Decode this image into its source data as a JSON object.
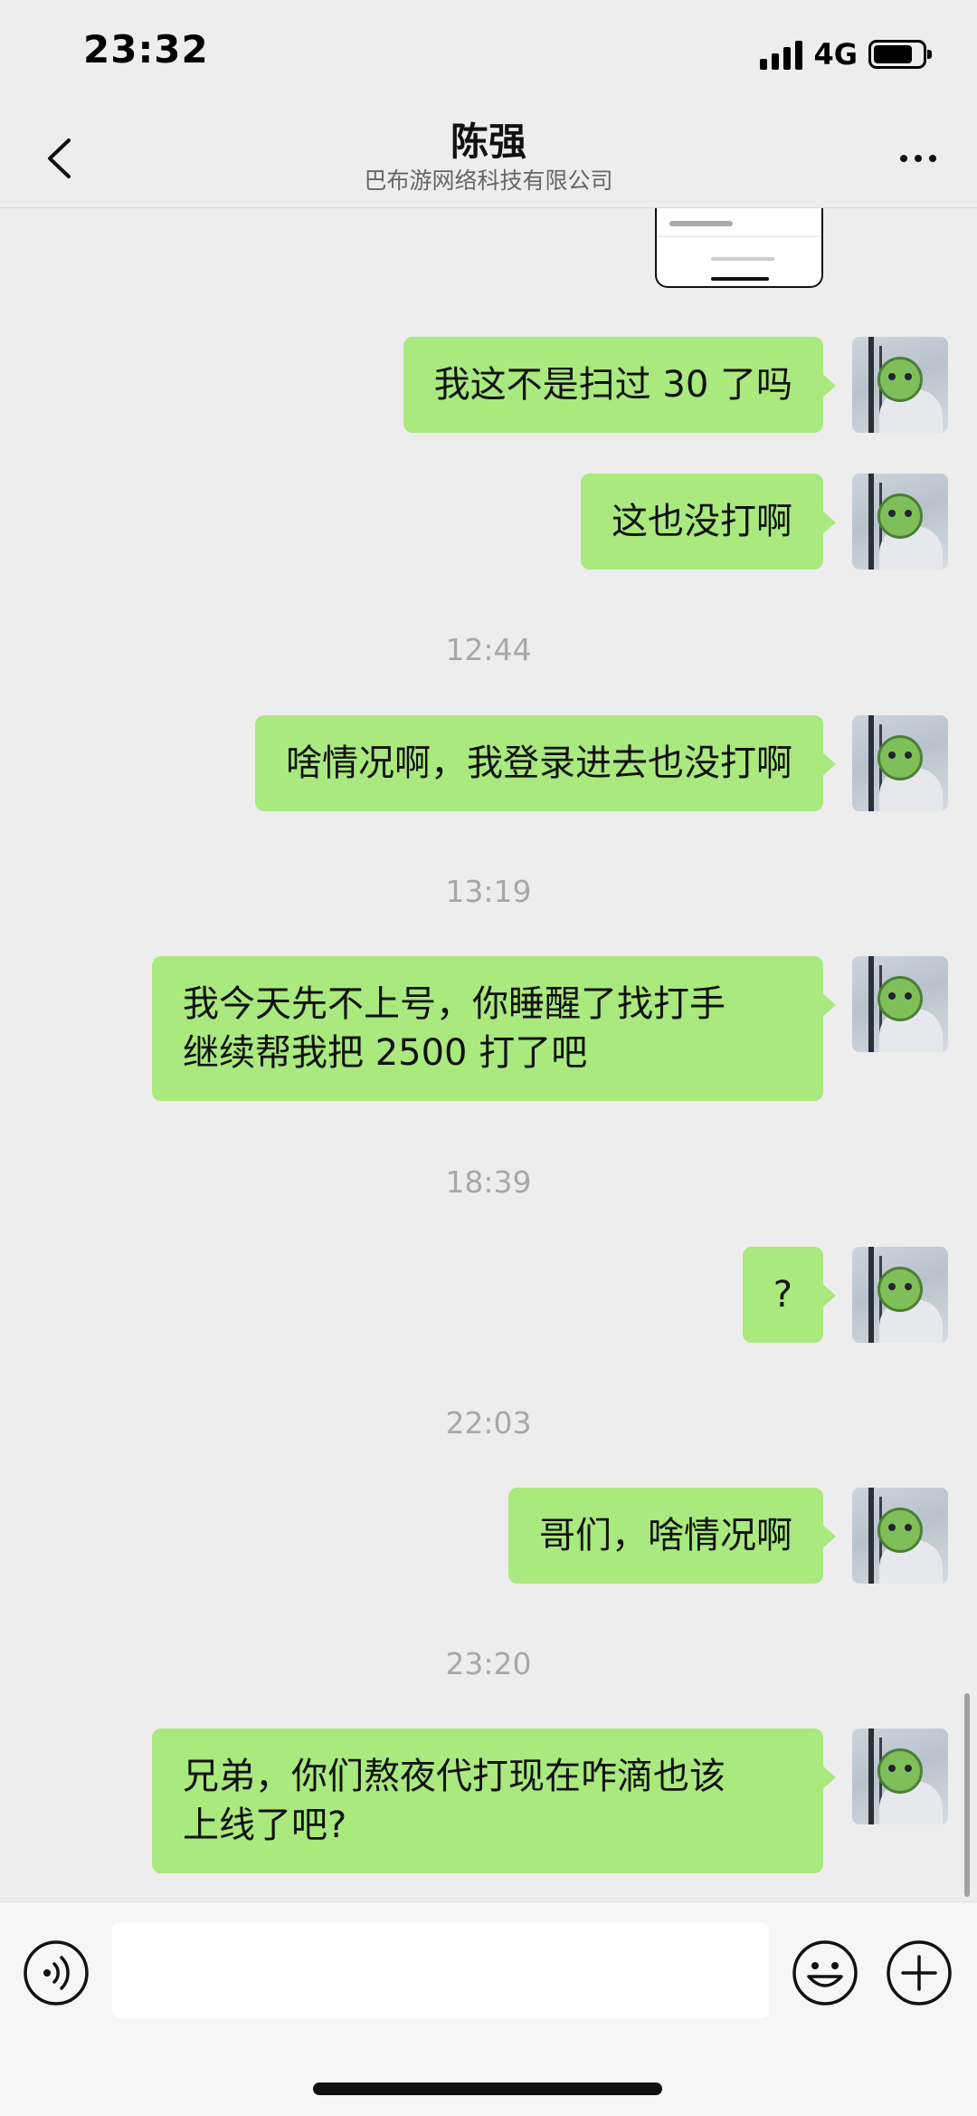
{
  "status_bar": {
    "time": "23:32",
    "network": "4G"
  },
  "header": {
    "title": "陈强",
    "subtitle": "巴布游网络科技有限公司"
  },
  "messages": [
    {
      "type": "text",
      "text": "我这不是扫过 30 了吗"
    },
    {
      "type": "text",
      "text": "这也没打啊"
    },
    {
      "type": "time",
      "text": "12:44"
    },
    {
      "type": "text",
      "text": "啥情况啊，我登录进去也没打啊"
    },
    {
      "type": "time",
      "text": "13:19"
    },
    {
      "type": "text",
      "lines": [
        "我今天先不上号，你睡醒了找打手",
        "继续帮我把 2500 打了吧"
      ]
    },
    {
      "type": "time",
      "text": "18:39"
    },
    {
      "type": "text",
      "text": "?"
    },
    {
      "type": "time",
      "text": "22:03"
    },
    {
      "type": "text",
      "text": "哥们，啥情况啊"
    },
    {
      "type": "time",
      "text": "23:20"
    },
    {
      "type": "text",
      "lines": [
        "兄弟，你们熬夜代打现在咋滴也该",
        "上线了吧?"
      ]
    }
  ],
  "input": {
    "value": ""
  },
  "colors": {
    "bubble": "#a9e97e",
    "background": "#ededed",
    "timestamp": "#a8a8a8"
  }
}
